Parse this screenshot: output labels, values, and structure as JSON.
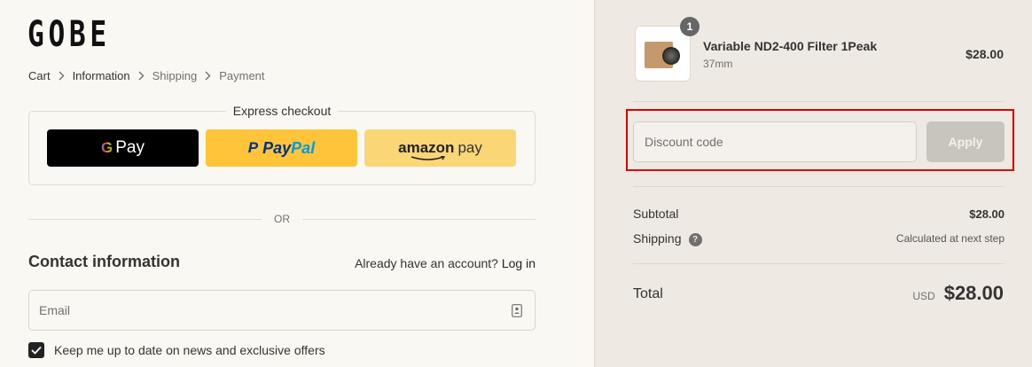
{
  "brand": {
    "logo_text": "GOBE"
  },
  "breadcrumb": {
    "items": [
      {
        "label": "Cart"
      },
      {
        "label": "Information"
      },
      {
        "label": "Shipping"
      },
      {
        "label": "Payment"
      }
    ]
  },
  "express_checkout": {
    "title": "Express checkout",
    "gpay_label": "Pay",
    "gpay_g": "G",
    "paypal_mark": "P",
    "paypal_pay": "Pay",
    "paypal_pal": "Pal",
    "amazon_word": "amazon",
    "amazon_pay": "pay"
  },
  "divider_or": "OR",
  "contact": {
    "title": "Contact information",
    "account_prompt": "Already have an account?",
    "login_link": "Log in",
    "email_placeholder": "Email",
    "newsletter_label": "Keep me up to date on news and exclusive offers",
    "newsletter_checked": true
  },
  "cart_item": {
    "quantity": "1",
    "name": "Variable ND2-400 Filter 1Peak",
    "variant": "37mm",
    "price": "$28.00"
  },
  "discount": {
    "placeholder": "Discount code",
    "apply_label": "Apply"
  },
  "summary": {
    "subtotal_label": "Subtotal",
    "subtotal_value": "$28.00",
    "shipping_label": "Shipping",
    "shipping_help": "?",
    "shipping_value": "Calculated at next step",
    "total_label": "Total",
    "currency": "USD",
    "total_value": "$28.00"
  },
  "colors": {
    "left_bg": "#faf8f3",
    "right_bg": "#eeeae3",
    "highlight_border": "#e00000",
    "paypal_yellow": "#ffc439",
    "amazon_yellow": "#fad676",
    "apply_disabled": "#c8c5bd"
  }
}
